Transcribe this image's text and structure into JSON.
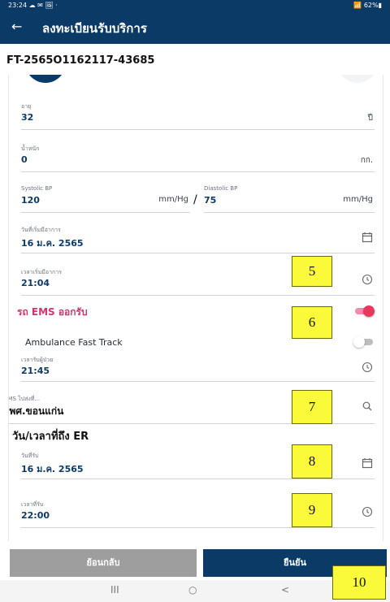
{
  "status_bar": {
    "time": "23:24 ☁ ✉ 🖼 ·",
    "right": "📶 62%▮"
  },
  "app_bar": {
    "back_icon": "arrow-left-icon",
    "title": "ลงทะเบียนรับบริการ"
  },
  "ticket_id": "FT-2565O1162117-43685",
  "form": {
    "age": {
      "label": "อายุ",
      "value": "32",
      "unit": "ปี"
    },
    "weight": {
      "label": "น้ำหนัก",
      "value": "0",
      "unit": "กก."
    },
    "systolic": {
      "label": "Systolic BP",
      "value": "120",
      "unit": "mm/Hg"
    },
    "separator": "/",
    "diastolic": {
      "label": "Diastolic BP",
      "value": "75",
      "unit": "mm/Hg"
    },
    "onset_date": {
      "label": "วันที่เริ่มมีอาการ",
      "value": "16 ม.ค. 2565",
      "icon": "calendar-icon"
    },
    "onset_time": {
      "label": "เวลาเริ่มมีอาการ",
      "value": "21:04",
      "icon": "clock-icon"
    },
    "ems": {
      "label": "รถ EMS ออกรับ",
      "on": true
    },
    "fast_track": {
      "label": "Ambulance Fast Track",
      "on": false
    },
    "pickup_time": {
      "label": "เวลารับผู้ป่วย",
      "value": "21:45",
      "icon": "clock-icon"
    },
    "ems_dest": {
      "label": "EMS ไปส่งที่...",
      "value": "รพศ.ขอนแก่น",
      "icon": "search-icon"
    },
    "er_section": "วัน/เวลาที่ถึง ER",
    "er_date": {
      "label": "วันที่รับ",
      "value": "16 ม.ค. 2565",
      "icon": "calendar-icon"
    },
    "er_time": {
      "label": "เวลาที่รับ",
      "value": "22:00",
      "icon": "clock-icon"
    }
  },
  "callouts": {
    "c5": "5",
    "c6": "6",
    "c7": "7",
    "c8": "8",
    "c9": "9",
    "c10": "10"
  },
  "buttons": {
    "back": "ย้อนกลับ",
    "confirm": "ยืนยัน"
  },
  "nav": {
    "recents": "III",
    "home": "○",
    "back": "<"
  },
  "colors": {
    "primary": "#0b3a66",
    "ems_accent": "#d6336c",
    "toggle_on": "#e8365d",
    "callout": "#fafa3a"
  }
}
